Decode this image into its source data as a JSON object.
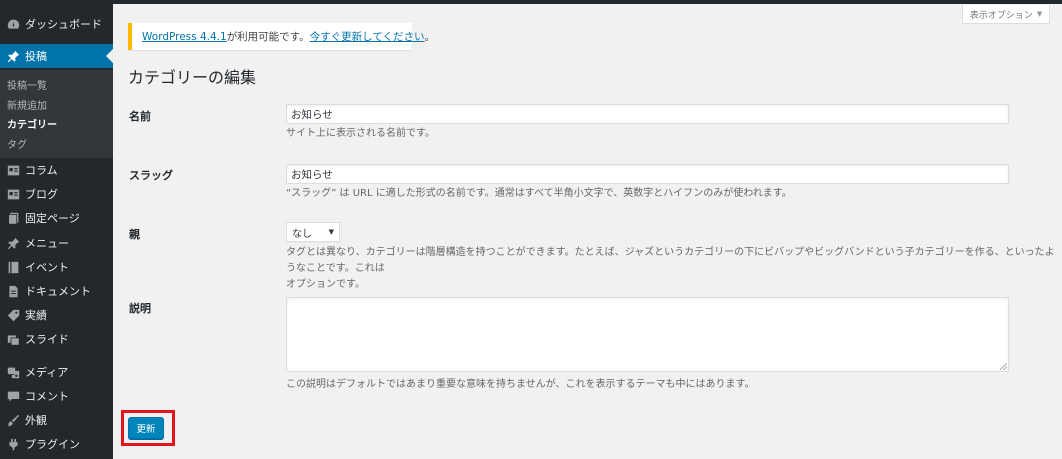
{
  "sidebar": {
    "top_items": [
      {
        "label": "ダッシュボード",
        "icon": "dashboard-icon"
      },
      {
        "label": "投稿",
        "icon": "pin-icon",
        "active": true
      }
    ],
    "submenu": [
      "投稿一覧",
      "新規追加",
      "カテゴリー",
      "タグ"
    ],
    "current_submenu": "カテゴリー",
    "items": [
      {
        "label": "コラム",
        "icon": "post-type-icon"
      },
      {
        "label": "ブログ",
        "icon": "post-type-icon"
      },
      {
        "label": "固定ページ",
        "icon": "page-icon"
      },
      {
        "label": "メニュー",
        "icon": "pin-icon"
      },
      {
        "label": "イベント",
        "icon": "book-icon"
      },
      {
        "label": "ドキュメント",
        "icon": "document-icon"
      },
      {
        "label": "実績",
        "icon": "tag-icon"
      },
      {
        "label": "スライド",
        "icon": "slides-icon"
      },
      {
        "label": "メディア",
        "icon": "media-icon"
      },
      {
        "label": "コメント",
        "icon": "comment-icon"
      },
      {
        "label": "外観",
        "icon": "brush-icon"
      },
      {
        "label": "プラグイン",
        "icon": "plugin-icon"
      }
    ]
  },
  "screen_options": "表示オプション",
  "notice": {
    "link1": "WordPress 4.4.1",
    "text": " が利用可能です。",
    "link2": "今すぐ更新してください",
    "tail": "。"
  },
  "page_title": "カテゴリーの編集",
  "form": {
    "name": {
      "label": "名前",
      "value": "お知らせ",
      "desc": "サイト上に表示される名前です。"
    },
    "slug": {
      "label": "スラッグ",
      "value": "お知らせ",
      "desc": "“スラッグ” は URL に適した形式の名前です。通常はすべて半角小文字で、英数字とハイフンのみが使われます。"
    },
    "parent": {
      "label": "親",
      "selected": "なし",
      "desc_line1": "タグとは異なり、カテゴリーは階層構造を持つことができます。たとえば、ジャズというカテゴリーの下にビバップやビッグバンドという子カテゴリーを作る、といったようなことです。これは",
      "desc_line2": "オプションです。"
    },
    "description": {
      "label": "説明",
      "value": "",
      "desc": "この説明はデフォルトではあまり重要な意味を持ちませんが、これを表示するテーマも中にはあります。"
    },
    "submit": "更新"
  },
  "colors": {
    "sidebar_bg": "#23282d",
    "active": "#0073aa",
    "button": "#0085ba",
    "highlight": "#e3131b",
    "notice_border": "#ffba00"
  }
}
